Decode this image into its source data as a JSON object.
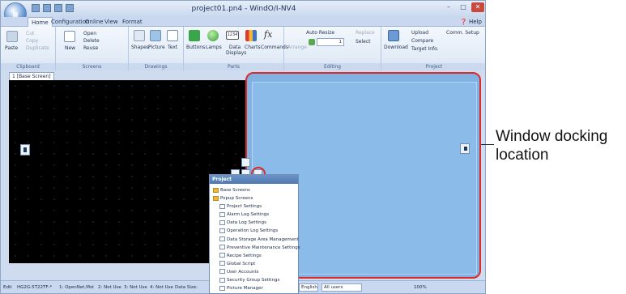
{
  "window": {
    "title": "project01.pn4 - WindO/I-NV4",
    "app_button": "WindO/I"
  },
  "ribbon_tabs": [
    {
      "label": "Home"
    },
    {
      "label": "Configuration"
    },
    {
      "label": "Online"
    },
    {
      "label": "View"
    },
    {
      "label": "Format"
    }
  ],
  "help_label": "Help",
  "groups": {
    "clipboard": {
      "label": "Clipboard",
      "paste": "Paste",
      "cut": "Cut",
      "copy": "Copy",
      "duplicate": "Duplicate"
    },
    "screens": {
      "label": "Screens",
      "new": "New",
      "open": "Open",
      "delete": "Delete",
      "reuse": "Reuse"
    },
    "drawings": {
      "label": "Drawings",
      "shapes": "Shapes",
      "picture": "Picture",
      "text": "Text"
    },
    "parts": {
      "label": "Parts",
      "buttons": "Buttons",
      "lamps": "Lamps",
      "data_displays": "Data Displays",
      "charts": "Charts",
      "commands": "Commands",
      "data_value": "1234",
      "fx": "fx"
    },
    "editing": {
      "label": "Editing",
      "arrange": "Arrange",
      "auto_resize": "Auto Resize",
      "replace": "Replace",
      "select": "Select",
      "value": "1"
    },
    "project": {
      "label": "Project",
      "download": "Download",
      "upload": "Upload",
      "compare": "Compare",
      "comm_setup": "Comm. Setup",
      "target_info": "Target Info."
    }
  },
  "doc_tab": "1 [Base Screen]",
  "project_panel": {
    "title": "Project",
    "items": [
      {
        "label": "Base Screens",
        "icon": "folder-icon"
      },
      {
        "label": "Popup Screens",
        "icon": "folder-icon"
      },
      {
        "label": "Project Settings",
        "icon": "document-icon"
      },
      {
        "label": "Alarm Log Settings",
        "icon": "document-icon"
      },
      {
        "label": "Data Log Settings",
        "icon": "document-icon"
      },
      {
        "label": "Operation Log Settings",
        "icon": "document-icon"
      },
      {
        "label": "Data Storage Area Management",
        "icon": "document-icon"
      },
      {
        "label": "Preventive Maintenance Settings",
        "icon": "document-icon"
      },
      {
        "label": "Recipe Settings",
        "icon": "document-icon"
      },
      {
        "label": "Global Script",
        "icon": "document-icon"
      },
      {
        "label": "User Accounts",
        "icon": "document-icon"
      },
      {
        "label": "Security Group Settings",
        "icon": "document-icon"
      },
      {
        "label": "Picture Manager",
        "icon": "document-icon"
      }
    ]
  },
  "statusbar": {
    "mode": "Edit",
    "model": "HG2G-5T22TF-*",
    "port1": "1: OpenNet,Mst",
    "port2": "2: Not Use",
    "port3": "3: Not Use",
    "port4": "4: Not Use",
    "data_size": "Data Size:",
    "language": "English",
    "users": "All users",
    "zoom": "100%"
  },
  "callout": {
    "line1": "Window docking",
    "line2": "location"
  },
  "colors": {
    "dock_pane": "#80b3e3",
    "highlight": "#dc2a2a",
    "canvas": "#000000"
  }
}
